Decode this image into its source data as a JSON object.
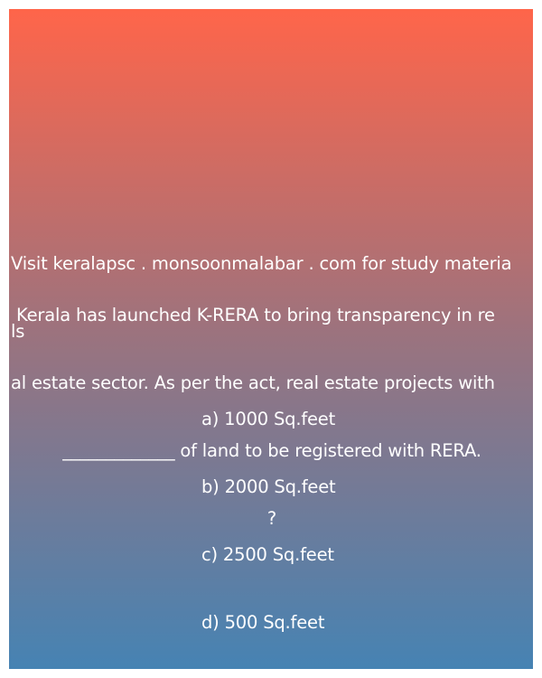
{
  "promo": {
    "lines": [
      "Visit keralapsc . monsoonmalabar . com for study materia",
      "ls"
    ]
  },
  "question": {
    "lines": [
      " Kerala has launched K-RERA to bring transparency in re",
      "al estate sector. As per the act, real estate projects with ",
      "_____________ of land to be registered with RERA.",
      "?"
    ]
  },
  "options": [
    "a) 1000 Sq.feet",
    "b) 2000 Sq.feet",
    "c) 2500 Sq.feet",
    "d) 500 Sq.feet"
  ],
  "colors": {
    "gradient_top": "#ff654a",
    "gradient_bottom": "#4683b3",
    "text": "#ffffff"
  }
}
